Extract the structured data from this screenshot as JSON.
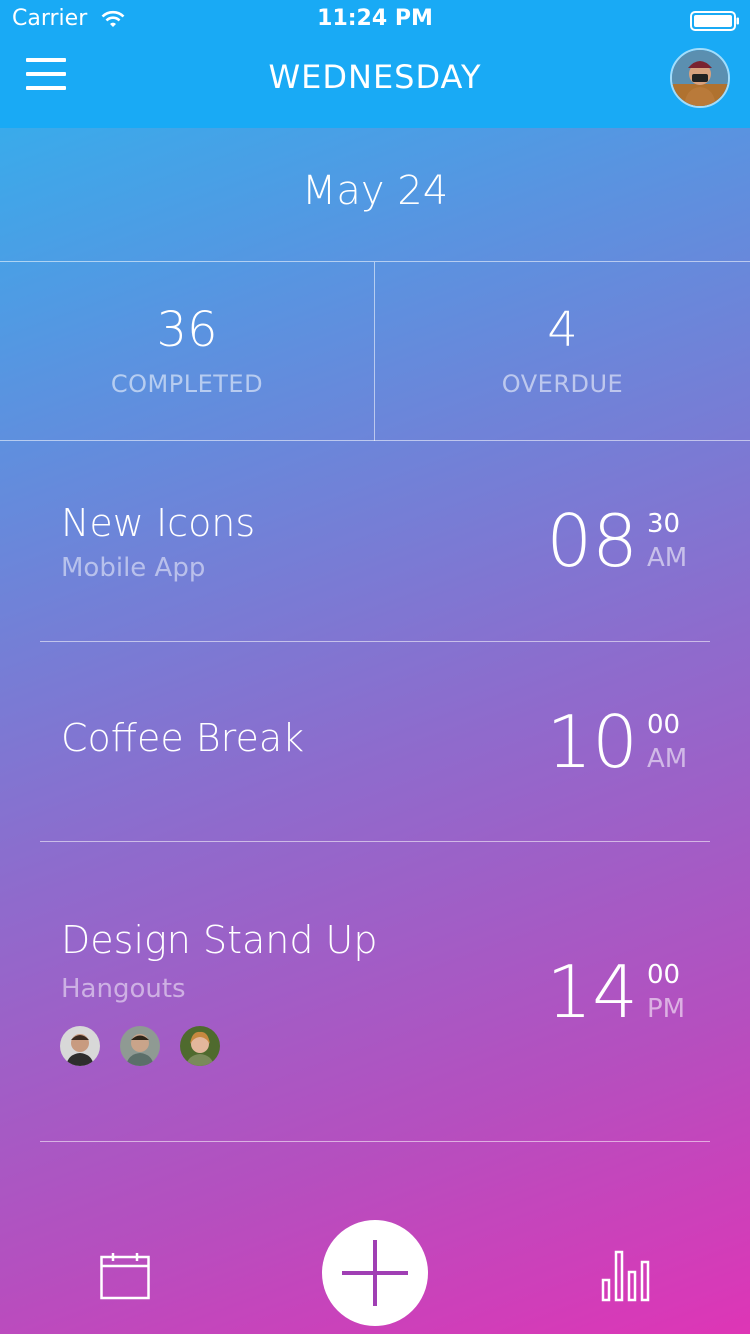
{
  "status_bar": {
    "carrier": "Carrier",
    "time": "11:24 PM"
  },
  "header": {
    "title": "WEDNESDAY",
    "menu_icon": "hamburger-menu-icon",
    "avatar": "user-avatar"
  },
  "date": {
    "label": "May 24"
  },
  "stats": {
    "completed": {
      "value": "36",
      "label": "COMPLETED"
    },
    "overdue": {
      "value": "4",
      "label": "OVERDUE"
    }
  },
  "tasks": [
    {
      "title": "New Icons",
      "subtitle": "Mobile App",
      "hour": "08",
      "minute": "30",
      "ampm": "AM"
    },
    {
      "title": "Coffee Break",
      "subtitle": "",
      "hour": "10",
      "minute": "00",
      "ampm": "AM"
    },
    {
      "title": "Design Stand Up",
      "subtitle": "Hangouts",
      "hour": "14",
      "minute": "00",
      "ampm": "PM"
    }
  ],
  "bottom_bar": {
    "left_icon": "calendar-icon",
    "center_icon": "plus-icon",
    "right_icon": "bar-chart-icon"
  },
  "colors": {
    "header_bg": "#19aaf5",
    "gradient_top": "#2ab6f0",
    "gradient_bottom": "#de35b6",
    "plus_accent": "#a03fb4"
  }
}
